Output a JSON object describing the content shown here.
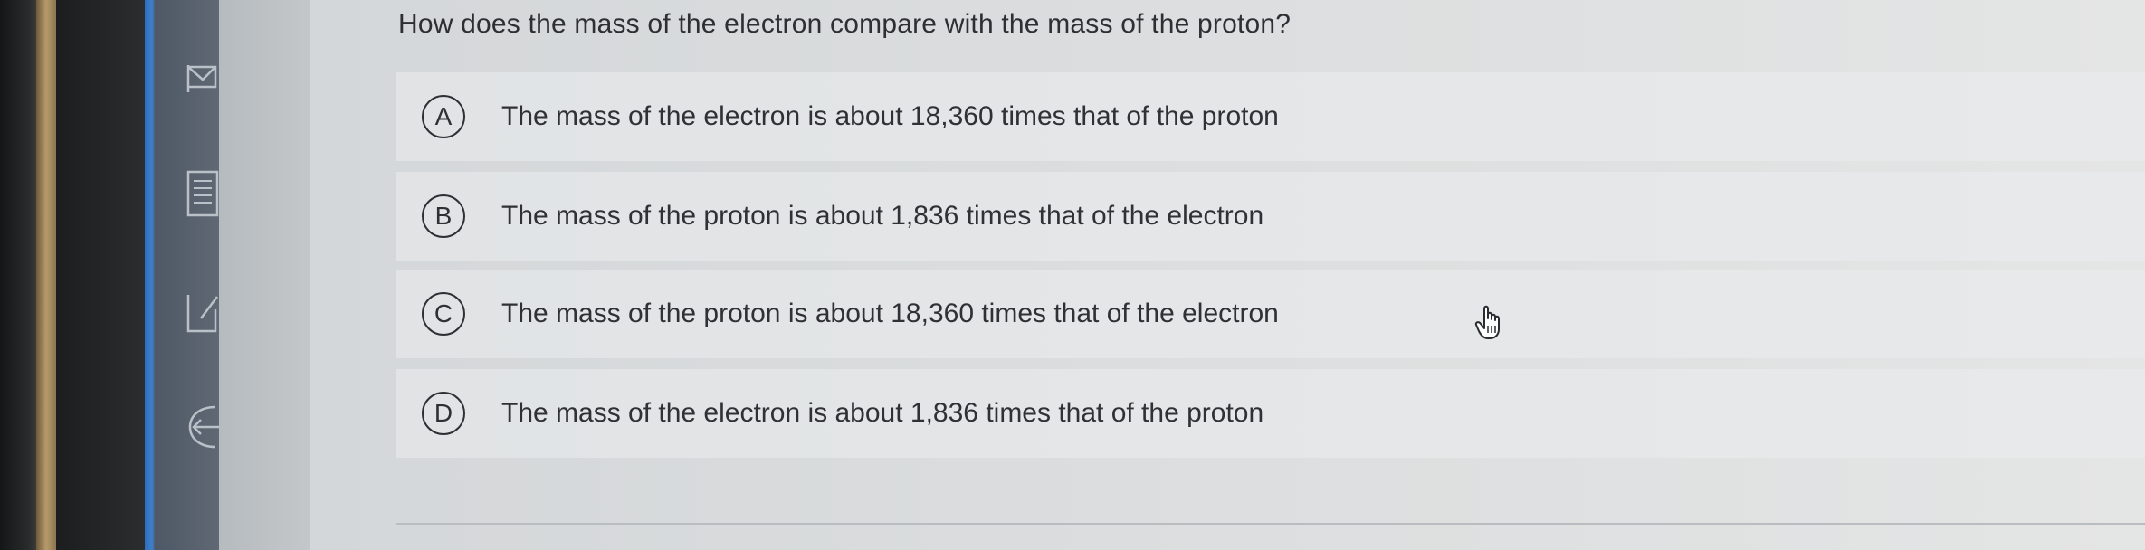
{
  "question": {
    "text": "How does the mass of the electron compare with the mass of the proton?"
  },
  "options": [
    {
      "letter": "A",
      "text": "The mass of the electron is about 18,360 times that of the proton"
    },
    {
      "letter": "B",
      "text": "The mass of the proton is about 1,836 times that of the electron"
    },
    {
      "letter": "C",
      "text": "The mass of the proton is about 18,360 times that of the electron"
    },
    {
      "letter": "D",
      "text": "The mass of the electron is about 1,836 times that of the proton"
    }
  ],
  "sidebar": {
    "icons": [
      "flag-icon",
      "notes-icon",
      "edit-icon",
      "exit-icon"
    ]
  },
  "colors": {
    "rail_accent": "#2e6fbd",
    "text": "#2f3135"
  }
}
